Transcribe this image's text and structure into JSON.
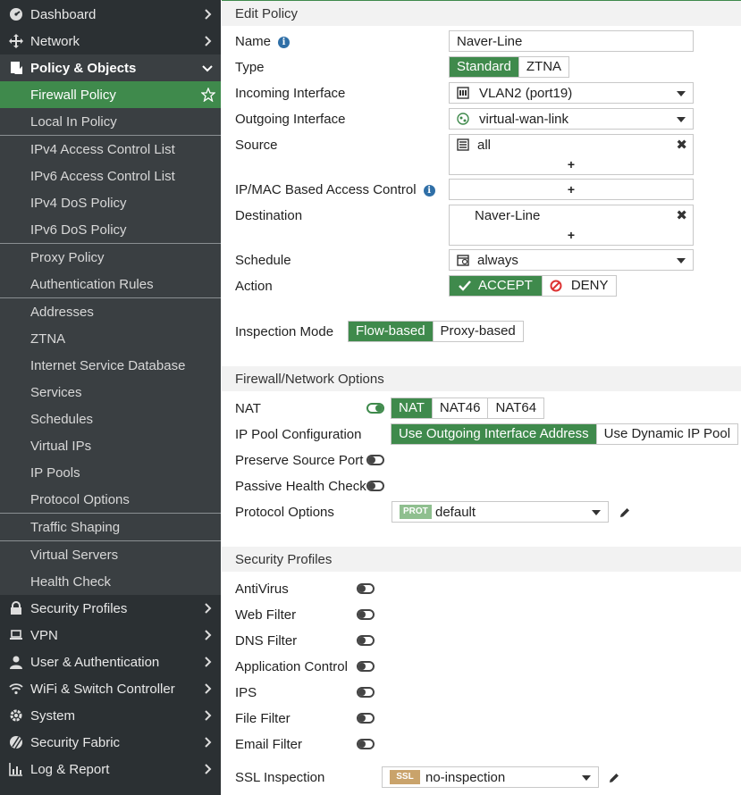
{
  "sidebar": {
    "top_items": [
      {
        "label": "Dashboard",
        "icon": "dashboard-icon"
      },
      {
        "label": "Network",
        "icon": "network-icon"
      },
      {
        "label": "Policy & Objects",
        "icon": "policy-icon"
      }
    ],
    "policy_items": [
      "Firewall Policy",
      "Local In Policy",
      "IPv4 Access Control List",
      "IPv6 Access Control List",
      "IPv4 DoS Policy",
      "IPv6 DoS Policy",
      "Proxy Policy",
      "Authentication Rules",
      "Addresses",
      "ZTNA",
      "Internet Service Database",
      "Services",
      "Schedules",
      "Virtual IPs",
      "IP Pools",
      "Protocol Options",
      "Traffic Shaping",
      "Virtual Servers",
      "Health Check"
    ],
    "bottom_items": [
      {
        "label": "Security Profiles",
        "icon": "lock-icon"
      },
      {
        "label": "VPN",
        "icon": "laptop-icon"
      },
      {
        "label": "User & Authentication",
        "icon": "user-icon"
      },
      {
        "label": "WiFi & Switch Controller",
        "icon": "wifi-icon"
      },
      {
        "label": "System",
        "icon": "gear-icon"
      },
      {
        "label": "Security Fabric",
        "icon": "fabric-icon"
      },
      {
        "label": "Log & Report",
        "icon": "chart-icon"
      }
    ]
  },
  "form": {
    "header": "Edit Policy",
    "name_label": "Name",
    "name_value": "Naver-Line",
    "type_label": "Type",
    "type_options": [
      "Standard",
      "ZTNA"
    ],
    "incoming_label": "Incoming Interface",
    "incoming_value": "VLAN2 (port19)",
    "outgoing_label": "Outgoing Interface",
    "outgoing_value": "virtual-wan-link",
    "source_label": "Source",
    "source_value": "all",
    "ipmac_label": "IP/MAC Based Access Control",
    "destination_label": "Destination",
    "destination_value": "Naver-Line",
    "schedule_label": "Schedule",
    "schedule_value": "always",
    "action_label": "Action",
    "action_accept": "ACCEPT",
    "action_deny": "DENY",
    "inspection_label": "Inspection Mode",
    "inspection_options": [
      "Flow-based",
      "Proxy-based"
    ],
    "plus": "+",
    "remove": "✖"
  },
  "firewall": {
    "header": "Firewall/Network Options",
    "nat_label": "NAT",
    "nat_options": [
      "NAT",
      "NAT46",
      "NAT64"
    ],
    "ippool_label": "IP Pool Configuration",
    "ippool_options": [
      "Use Outgoing Interface Address",
      "Use Dynamic IP Pool"
    ],
    "preserve_label": "Preserve Source Port",
    "passive_label": "Passive Health Check",
    "protocol_label": "Protocol Options",
    "protocol_badge": "PROT",
    "protocol_value": "default"
  },
  "security": {
    "header": "Security Profiles",
    "items": [
      "AntiVirus",
      "Web Filter",
      "DNS Filter",
      "Application Control",
      "IPS",
      "File Filter",
      "Email Filter"
    ],
    "ssl_label": "SSL Inspection",
    "ssl_badge": "SSL",
    "ssl_value": "no-inspection"
  },
  "colors": {
    "sidebar_bg": "#2b3033",
    "accent_green": "#3f8a4c",
    "badge_prot": "#8fbf8f",
    "badge_ssl": "#c9a36b"
  }
}
